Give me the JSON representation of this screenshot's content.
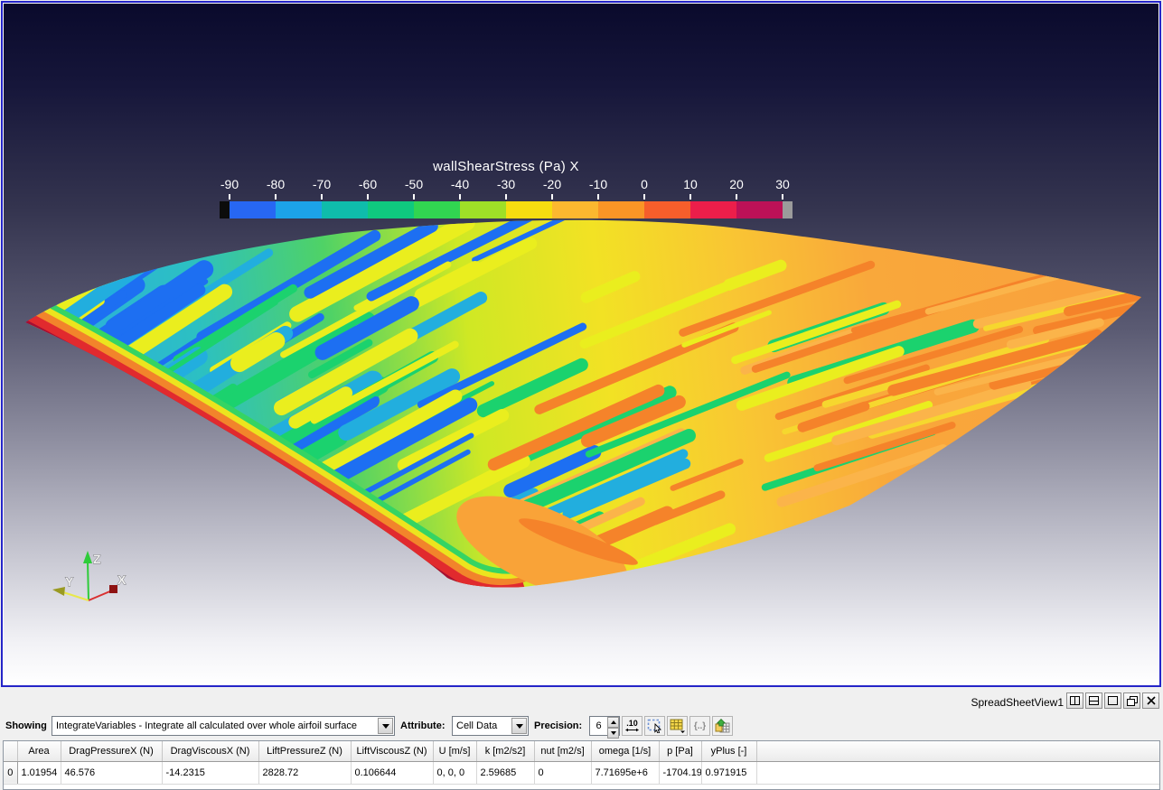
{
  "view": {
    "colorbar": {
      "title": "wallShearStress (Pa) X",
      "tick_labels": [
        "-90",
        "-80",
        "-70",
        "-60",
        "-50",
        "-40",
        "-30",
        "-20",
        "-10",
        "0",
        "10",
        "20",
        "30"
      ],
      "below_range_color": "#0c0c0c",
      "above_range_color": "#9b9b9b",
      "segment_colors": [
        "#2767f3",
        "#1ca3e8",
        "#0fbcab",
        "#0fc97f",
        "#31d551",
        "#9fdf27",
        "#f6dd10",
        "#fcb82f",
        "#fa9526",
        "#f65e2b",
        "#ec1e4a",
        "#bc1157"
      ]
    },
    "axes_triad": {
      "x_label": "X",
      "y_label": "Y",
      "z_label": "Z",
      "x_color": "#d93030",
      "y_color": "#e8e84a",
      "z_color": "#2ecc3a"
    },
    "surface": {
      "base_stops": [
        [
          0,
          "#2aa9e7"
        ],
        [
          0.16,
          "#2cc0c2"
        ],
        [
          0.28,
          "#4fd266"
        ],
        [
          0.4,
          "#cfe824"
        ],
        [
          0.52,
          "#f2e224"
        ],
        [
          0.64,
          "#f9c633"
        ],
        [
          0.76,
          "#f9a83b"
        ],
        [
          1,
          "#f9a03c"
        ]
      ],
      "edge_bands": [
        "#a50f33",
        "#e12a2e",
        "#f2842b",
        "#ece41e",
        "#35d463"
      ],
      "nose_color": "#f9a338",
      "streaks": {
        "blue": "#1d6ff2",
        "cyan": "#22aede",
        "green": "#1bd26e",
        "yellow": "#eaee1e",
        "yellow2": "#f6d72e",
        "orange_dark": "#f5832a",
        "orange_light": "#fbb44a"
      }
    }
  },
  "spreadsheet": {
    "view_title": "SpreadSheetView1",
    "window_buttons": [
      "split-horizontal",
      "split-vertical",
      "maximize",
      "restore",
      "close"
    ],
    "toolbar": {
      "showing_label": "Showing",
      "showing_value": "IntegrateVariables - Integrate all calculated over whole airfoil surface",
      "attribute_label": "Attribute:",
      "attribute_value": "Cell Data",
      "precision_label": "Precision:",
      "precision_value": "6",
      "fixed_notation_label": ".10",
      "expression_label": "{..}"
    },
    "table": {
      "columns": [
        "Area",
        "DragPressureX (N)",
        "DragViscousX (N)",
        "LiftPressureZ (N)",
        "LiftViscousZ (N)",
        "U [m/s]",
        "k [m2/s2]",
        "nut [m2/s]",
        "omega [1/s]",
        "p [Pa]",
        "yPlus [-]"
      ],
      "rows": [
        {
          "index": "0",
          "cells": [
            "1.01954",
            "46.576",
            "-14.2315",
            "2828.72",
            "0.106644",
            "0, 0, 0",
            "2.59685",
            "0",
            "7.71695e+6",
            "-1704.19",
            "0.971915"
          ]
        }
      ]
    }
  }
}
